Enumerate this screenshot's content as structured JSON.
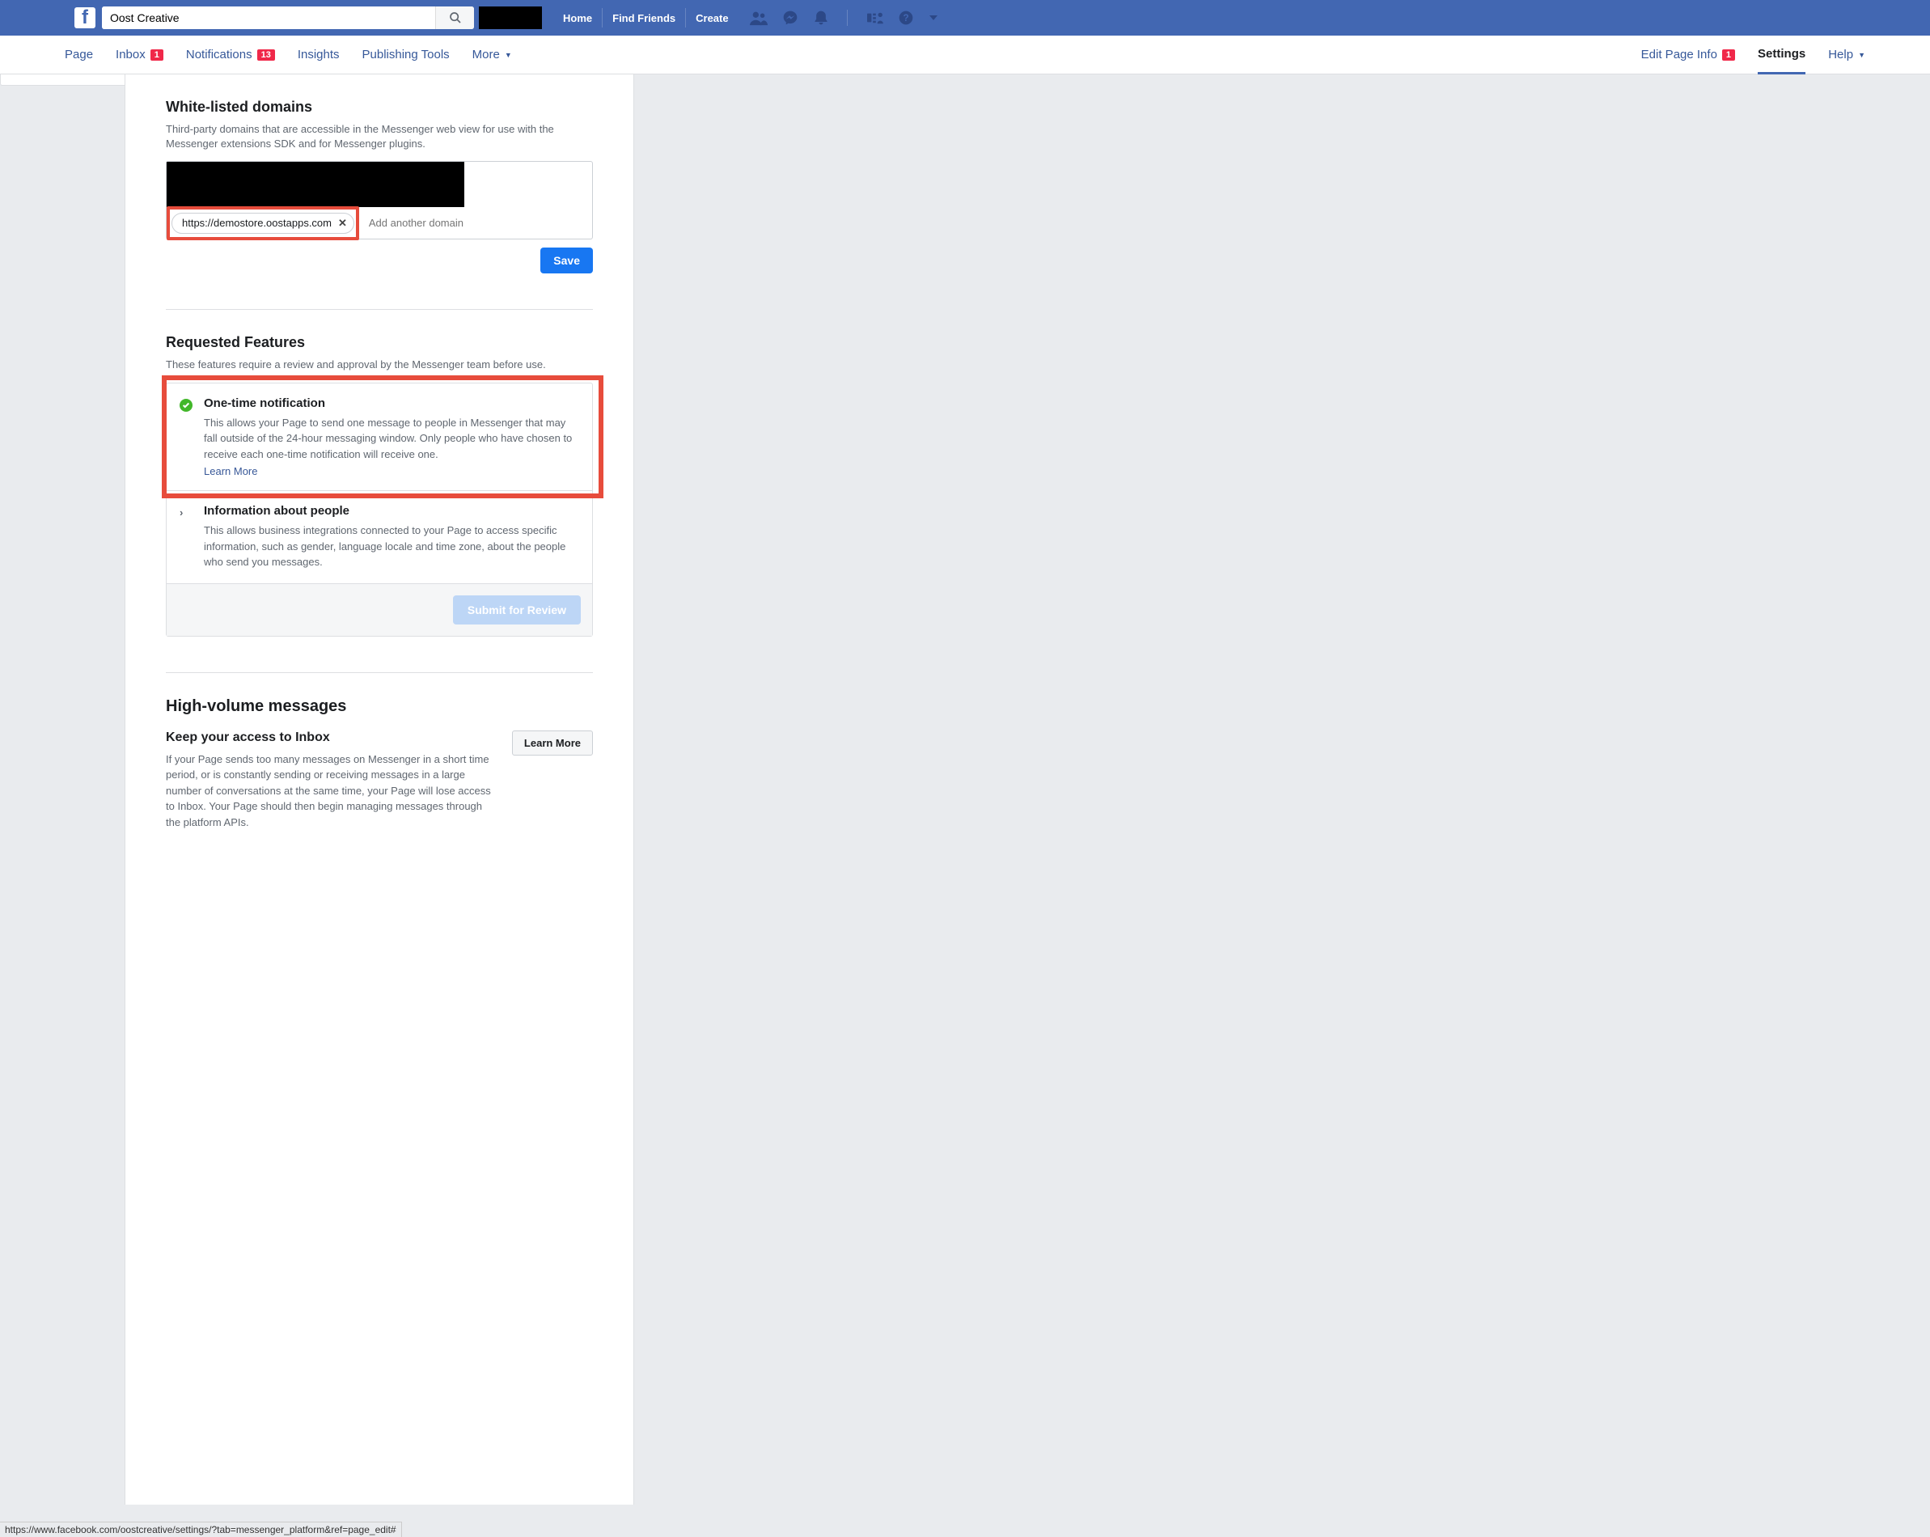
{
  "topbar": {
    "search_value": "Oost Creative",
    "links": {
      "home": "Home",
      "find_friends": "Find Friends",
      "create": "Create"
    }
  },
  "secondbar": {
    "left": {
      "page": "Page",
      "inbox": "Inbox",
      "inbox_badge": "1",
      "notifications": "Notifications",
      "notifications_badge": "13",
      "insights": "Insights",
      "publishing": "Publishing Tools",
      "more": "More"
    },
    "right": {
      "edit": "Edit Page Info",
      "edit_badge": "1",
      "settings": "Settings",
      "help": "Help"
    }
  },
  "whitelist": {
    "title": "White-listed domains",
    "desc": "Third-party domains that are accessible in the Messenger web view for use with the Messenger extensions SDK and for Messenger plugins.",
    "chip1": "https://demostore.oostapps.com",
    "add_placeholder": "Add another domain",
    "save": "Save"
  },
  "features": {
    "title": "Requested Features",
    "desc": "These features require a review and approval by the Messenger team before use.",
    "item1_title": "One-time notification",
    "item1_desc": "This allows your Page to send one message to people in Messenger that may fall outside of the 24-hour messaging window. Only people who have chosen to receive each one-time notification will receive one.",
    "learn_more": "Learn More",
    "item2_title": "Information about people",
    "item2_desc": "This allows business integrations connected to your Page to access specific information, such as gender, language locale and time zone, about the people who send you messages.",
    "submit": "Submit for Review"
  },
  "highvol": {
    "title": "High-volume messages",
    "sub_title": "Keep your access to Inbox",
    "sub_desc": "If your Page sends too many messages on Messenger in a short time period, or is constantly sending or receiving messages in a large number of conversations at the same time, your Page will lose access to Inbox. Your Page should then begin managing messages through the platform APIs.",
    "learn_more": "Learn More"
  },
  "status_url": "https://www.facebook.com/oostcreative/settings/?tab=messenger_platform&ref=page_edit#"
}
